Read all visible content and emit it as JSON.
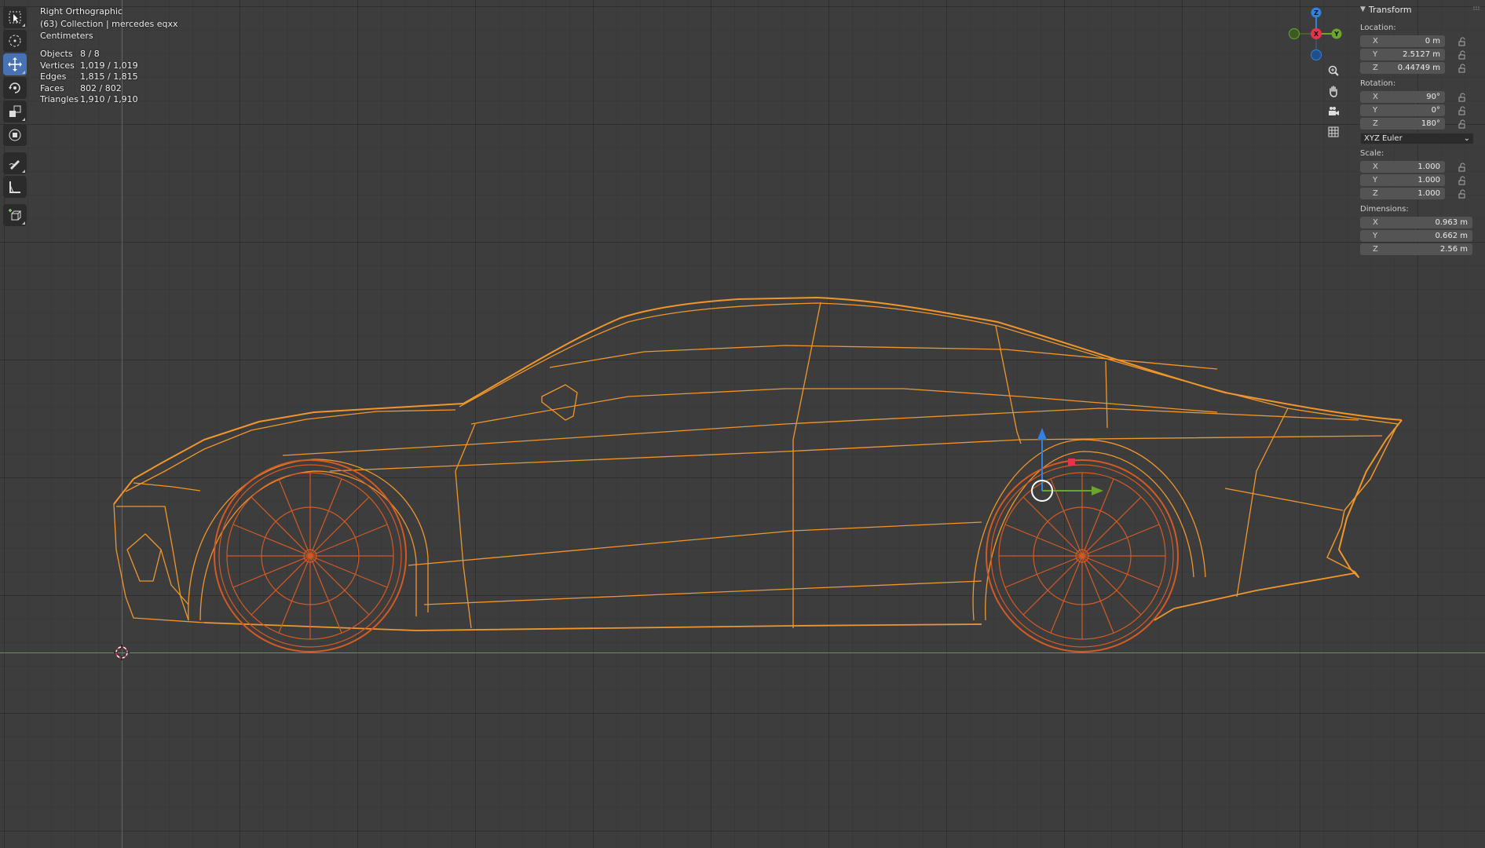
{
  "viewport": {
    "view_name": "Right Orthographic",
    "collection_line": "(63) Collection | mercedes eqxx",
    "units": "Centimeters"
  },
  "stats": [
    {
      "label": "Objects",
      "value": "8 / 8"
    },
    {
      "label": "Vertices",
      "value": "1,019 / 1,019"
    },
    {
      "label": "Edges",
      "value": "1,815 / 1,815"
    },
    {
      "label": "Faces",
      "value": "802 / 802"
    },
    {
      "label": "Triangles",
      "value": "1,910 / 1,910"
    }
  ],
  "toolbar": {
    "tools": [
      "select-box",
      "cursor",
      "move",
      "rotate",
      "scale",
      "transform",
      "annotate",
      "measure",
      "add-cube"
    ],
    "active_tool": "move"
  },
  "gizmo": {
    "z_label": "Z",
    "x_label": "X",
    "y_label": "Y",
    "colors": {
      "x": "#e8324b",
      "y": "#6ba52b",
      "z": "#2f82e0"
    }
  },
  "transform": {
    "title": "Transform",
    "location_label": "Location:",
    "location": {
      "x": "0 m",
      "y": "2.5127 m",
      "z": "0.44749 m"
    },
    "rotation_label": "Rotation:",
    "rotation": {
      "x": "90°",
      "y": "0°",
      "z": "180°"
    },
    "rotation_mode": "XYZ Euler",
    "scale_label": "Scale:",
    "scale": {
      "x": "1.000",
      "y": "1.000",
      "z": "1.000"
    },
    "dimensions_label": "Dimensions:",
    "dimensions": {
      "x": "0.963 m",
      "y": "0.662 m",
      "z": "2.56 m"
    },
    "axis_x": "X",
    "axis_y": "Y",
    "axis_z": "Z"
  },
  "colors": {
    "wire": "#f0962c",
    "wheel": "#d45a24",
    "accent": "#4772b3"
  }
}
